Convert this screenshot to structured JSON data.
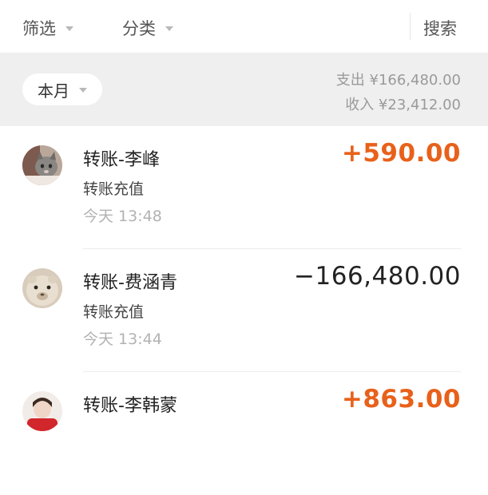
{
  "toolbar": {
    "filter_label": "筛选",
    "category_label": "分类",
    "search_label": "搜索"
  },
  "summary": {
    "month_label": "本月",
    "expense_text": "支出 ¥166,480.00",
    "income_text": "收入 ¥23,412.00"
  },
  "colors": {
    "income_amount": "#e8611a",
    "expense_amount": "#222222",
    "summary_bg": "#efefef"
  },
  "transactions": [
    {
      "title": "转账-李峰",
      "subtitle": "转账充值",
      "time": "今天 13:48",
      "amount": "+590.00",
      "avatar_icon": "cat-photo-avatar"
    },
    {
      "title": "转账-费涵青",
      "subtitle": "转账充值",
      "time": "今天 13:44",
      "amount": "−166,480.00",
      "avatar_icon": "alpaca-photo-avatar"
    },
    {
      "title": "转账-李韩蒙",
      "amount": "+863.00",
      "avatar_icon": "person-photo-avatar"
    }
  ]
}
